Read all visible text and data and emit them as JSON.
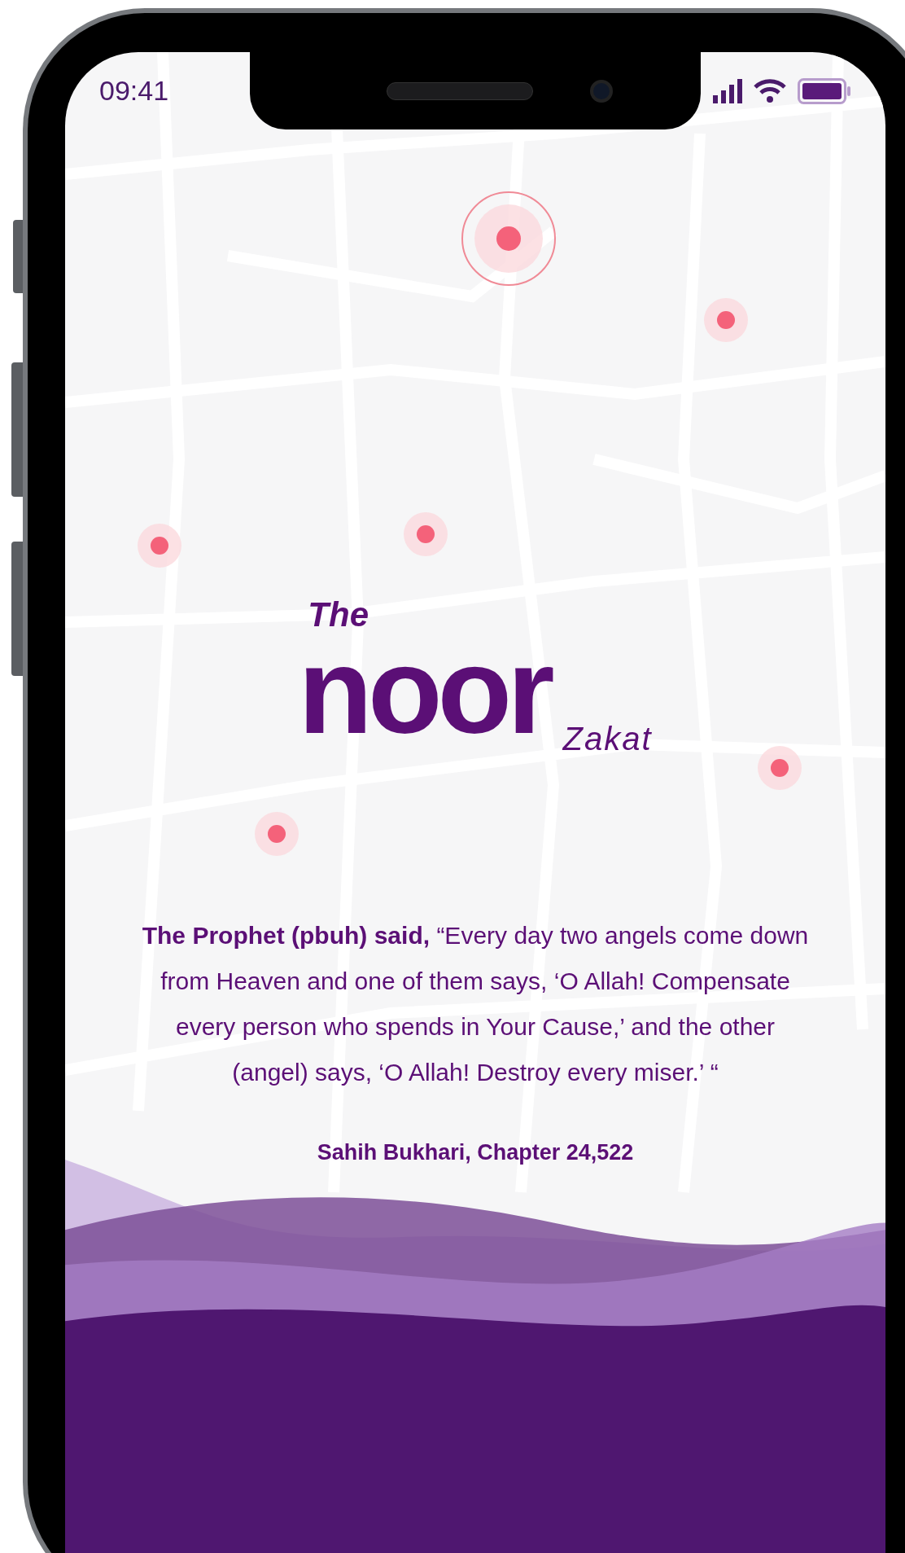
{
  "status_bar": {
    "time": "09:41"
  },
  "logo": {
    "prefix": "The",
    "name": "noor",
    "suffix": "Zakat"
  },
  "quote": {
    "text": "**The Prophet (pbuh) said,** “Every day two angels come down from Heaven and one of them says, ‘O Allah! Compensate every person who spends in Your Cause,’ and the other (angel) says, ‘O Allah! Destroy every miser.’ “",
    "source": "Sahih Bukhari, Chapter 24,522"
  }
}
